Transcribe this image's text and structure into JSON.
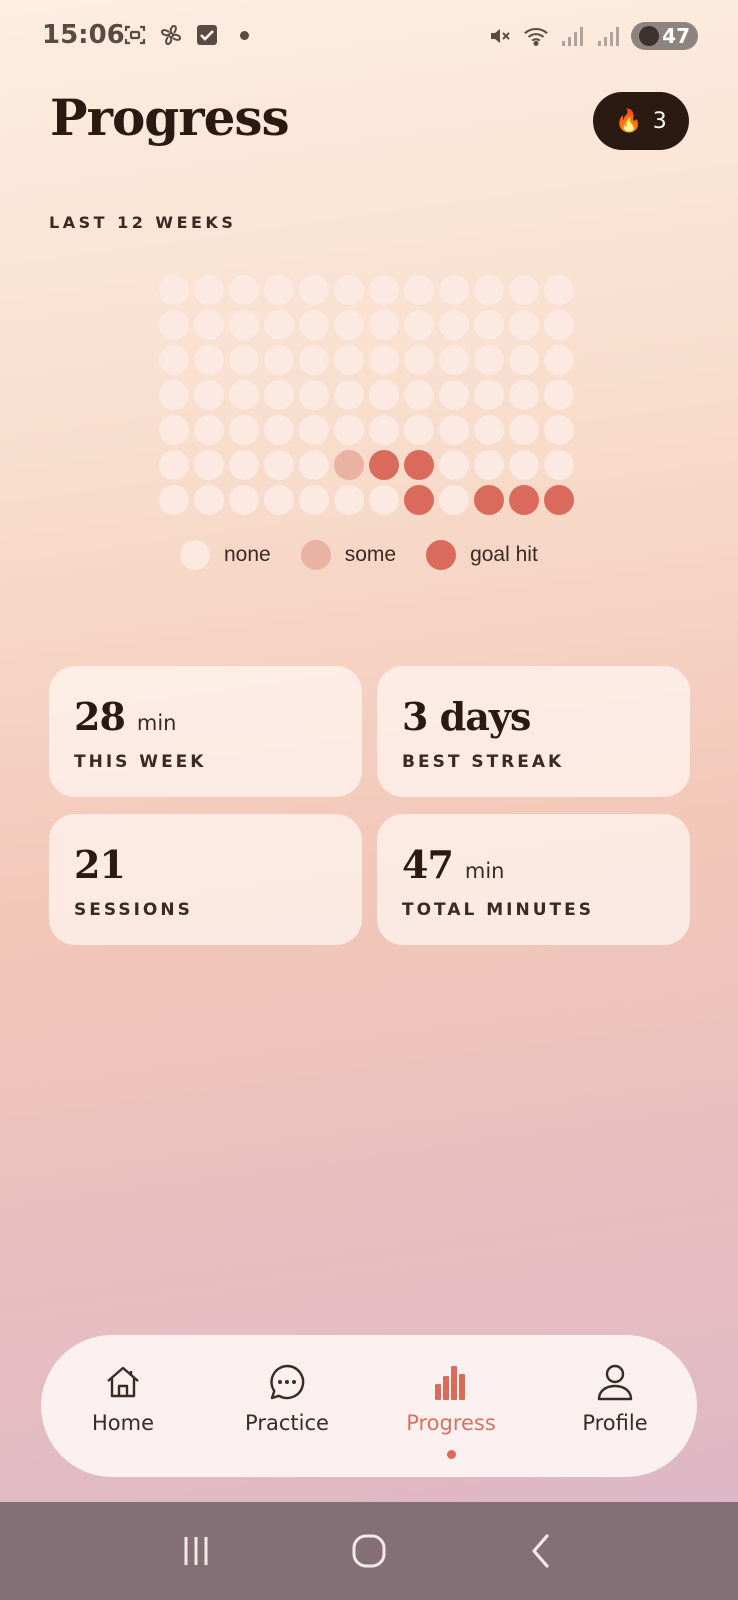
{
  "status_bar": {
    "time": "15:06",
    "battery": "47",
    "icons_left": [
      "screenshot-icon",
      "fan-icon",
      "checkbox-icon"
    ],
    "icons_right": [
      "mute-icon",
      "wifi-icon",
      "signal-icon",
      "signal-roaming-icon"
    ]
  },
  "header": {
    "title": "Progress",
    "streak": {
      "icon": "flame-icon",
      "count": "3"
    }
  },
  "heatmap": {
    "label": "LAST 12 WEEKS",
    "weeks": 12,
    "days": 7,
    "levels": [
      [
        0,
        0,
        0,
        0,
        0,
        0,
        0,
        0,
        0,
        0,
        0,
        0
      ],
      [
        0,
        0,
        0,
        0,
        0,
        0,
        0,
        0,
        0,
        0,
        0,
        0
      ],
      [
        0,
        0,
        0,
        0,
        0,
        0,
        0,
        0,
        0,
        0,
        0,
        0
      ],
      [
        0,
        0,
        0,
        0,
        0,
        0,
        0,
        0,
        0,
        0,
        0,
        0
      ],
      [
        0,
        0,
        0,
        0,
        0,
        0,
        0,
        0,
        0,
        0,
        0,
        0
      ],
      [
        0,
        0,
        0,
        0,
        0,
        1,
        2,
        2,
        0,
        0,
        0,
        0
      ],
      [
        0,
        0,
        0,
        0,
        0,
        0,
        0,
        2,
        0,
        2,
        2,
        2
      ]
    ],
    "legend": [
      {
        "label": "none",
        "level": 0
      },
      {
        "label": "some",
        "level": 1
      },
      {
        "label": "goal hit",
        "level": 2
      }
    ],
    "colors": {
      "none": "#fbe9e2",
      "some": "#eab2a2",
      "goal_hit": "#d96a5c"
    }
  },
  "stats": {
    "this_week": {
      "value": "28",
      "unit": "min",
      "label": "THIS WEEK"
    },
    "best_streak": {
      "value": "3 days",
      "unit": "",
      "label": "BEST STREAK"
    },
    "sessions": {
      "value": "21",
      "unit": "",
      "label": "SESSIONS"
    },
    "total_minutes": {
      "value": "47",
      "unit": "min",
      "label": "TOTAL MINUTES"
    }
  },
  "nav": {
    "items": [
      {
        "label": "Home",
        "icon": "home-icon",
        "active": false
      },
      {
        "label": "Practice",
        "icon": "chat-bubble-icon",
        "active": false
      },
      {
        "label": "Progress",
        "icon": "bar-chart-icon",
        "active": true
      },
      {
        "label": "Profile",
        "icon": "person-icon",
        "active": false
      }
    ],
    "accent_color": "#d9735f"
  },
  "system_nav": [
    "recent-apps-icon",
    "home-circle-icon",
    "back-icon"
  ]
}
